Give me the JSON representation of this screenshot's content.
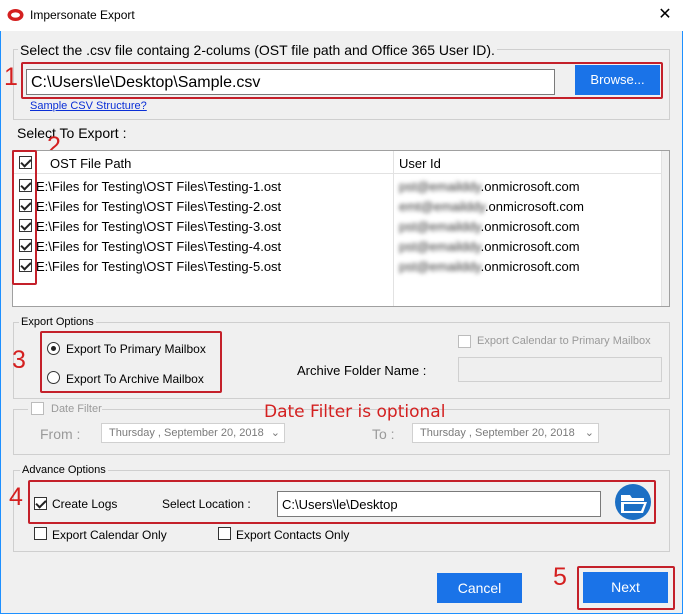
{
  "window": {
    "title": "Impersonate Export",
    "close_glyph": "✕"
  },
  "csv": {
    "instruction": "Select the .csv file containg 2-colums (OST file path and Office 365 User ID).",
    "path_value": "C:\\Users\\le\\Desktop\\Sample.csv",
    "browse_label": "Browse...",
    "sample_link": "Sample CSV Structure?"
  },
  "select_export": {
    "label": "Select To Export :",
    "columns": [
      "OST File Path",
      "User Id"
    ],
    "rows": [
      {
        "checked": true,
        "path": "E:\\Files for Testing\\OST Files\\Testing-1.ost",
        "user_prefix": "pst@emailddy",
        "user_suffix": ".onmicrosoft.com"
      },
      {
        "checked": true,
        "path": "E:\\Files for Testing\\OST Files\\Testing-2.ost",
        "user_prefix": "emt@emailddy",
        "user_suffix": ".onmicrosoft.com"
      },
      {
        "checked": true,
        "path": "E:\\Files for Testing\\OST Files\\Testing-3.ost",
        "user_prefix": "pst@emailddy",
        "user_suffix": ".onmicrosoft.com"
      },
      {
        "checked": true,
        "path": "E:\\Files for Testing\\OST Files\\Testing-4.ost",
        "user_prefix": "pst@emailddy",
        "user_suffix": ".onmicrosoft.com"
      },
      {
        "checked": true,
        "path": "E:\\Files for Testing\\OST Files\\Testing-5.ost",
        "user_prefix": "pst@emailddy",
        "user_suffix": ".onmicrosoft.com"
      }
    ]
  },
  "export_options": {
    "group_label": "Export Options",
    "primary_label": "Export To Primary Mailbox",
    "archive_label": "Export To Archive Mailbox",
    "selected": "primary",
    "calendar_primary_label": "Export Calendar to Primary Mailbox",
    "archive_folder_label": "Archive Folder Name :",
    "archive_folder_value": ""
  },
  "date_filter": {
    "label": "Date Filter",
    "from_label": "From :",
    "to_label": "To :",
    "from_value": "Thursday   , September 20, 2018",
    "to_value": "Thursday   , September 20, 2018",
    "note": "Date Filter is optional"
  },
  "advance_options": {
    "group_label": "Advance Options",
    "create_logs_label": "Create Logs",
    "create_logs_checked": true,
    "select_location_label": "Select Location :",
    "location_value": "C:\\Users\\le\\Desktop",
    "calendar_only_label": "Export Calendar Only",
    "contacts_only_label": "Export Contacts Only"
  },
  "footer": {
    "cancel_label": "Cancel",
    "next_label": "Next"
  },
  "annotations": {
    "n1": "1",
    "n2": "2",
    "n3": "3",
    "n4": "4",
    "n5": "5"
  },
  "colors": {
    "accent": "#1a73e8",
    "annotation_red": "#c4202a",
    "window_border": "#1e90ff"
  }
}
